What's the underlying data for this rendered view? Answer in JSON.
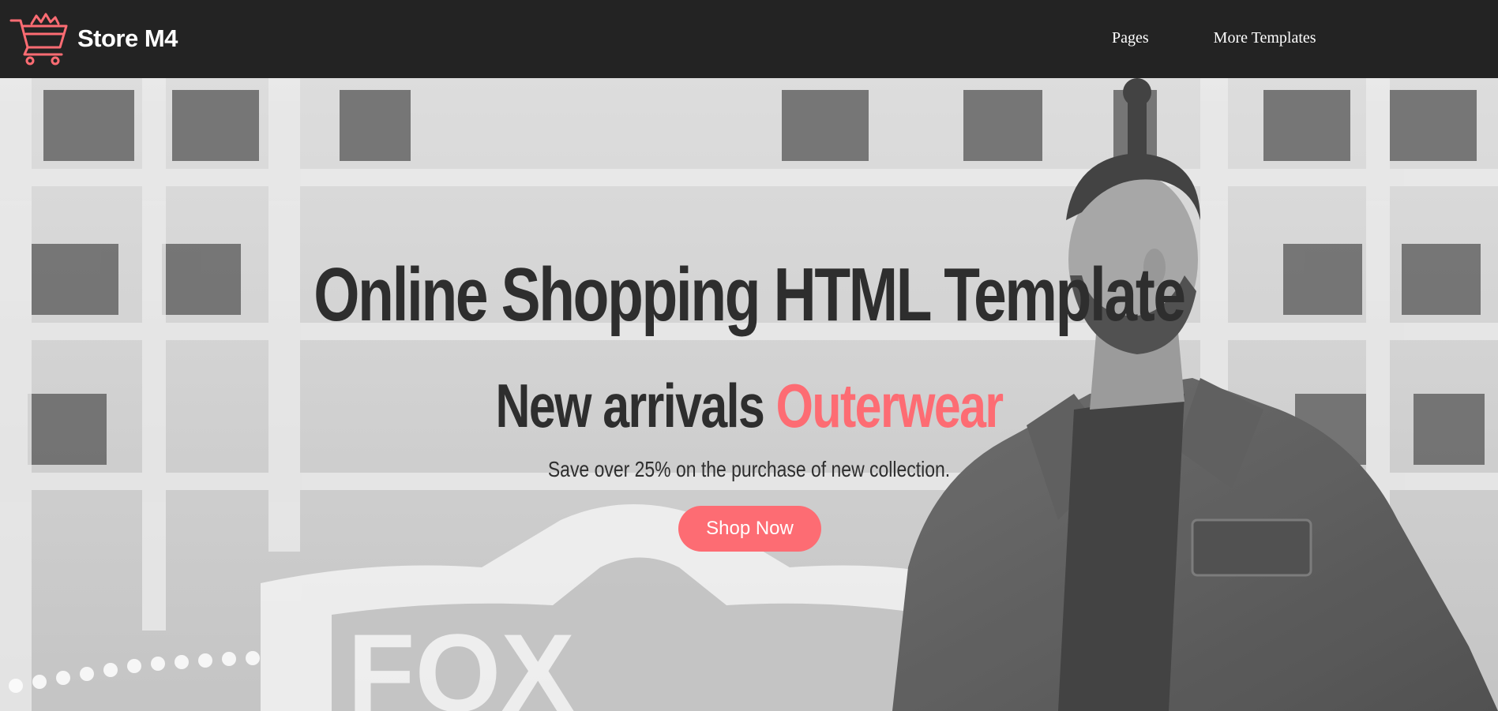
{
  "brand": {
    "name": "Store M4",
    "icon": "shopping-cart-icon",
    "accent_color": "#fd6c73"
  },
  "nav": {
    "items": [
      {
        "label": "Pages"
      },
      {
        "label": "More Templates"
      }
    ]
  },
  "hero": {
    "title": "Online Shopping HTML Template",
    "subtitle_prefix": "New arrivals",
    "subtitle_highlight": "Outerwear",
    "text": "Save over 25% on the purchase of new collection.",
    "button_label": "Shop Now",
    "background_image": "black-and-white-man-denim-jacket-photo"
  },
  "colors": {
    "navbar_bg": "#232323",
    "heading": "#2e2e2e",
    "accent": "#fd6c73",
    "nav_text": "#ffffff"
  }
}
